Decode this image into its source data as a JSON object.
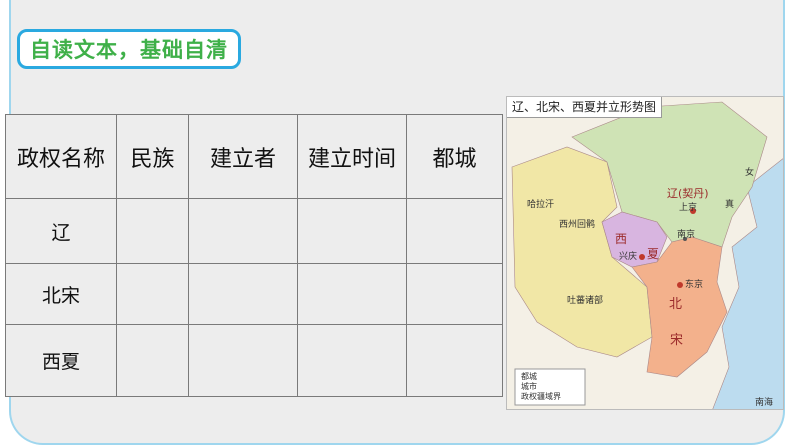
{
  "heading": "自读文本，基础自清",
  "table": {
    "headers": [
      "政权名称",
      "民族",
      "建立者",
      "建立时间",
      "都城"
    ],
    "rows": [
      {
        "name": "辽",
        "cells": [
          "",
          "",
          "",
          ""
        ]
      },
      {
        "name": "北宋",
        "cells": [
          "",
          "",
          "",
          ""
        ]
      },
      {
        "name": "西夏",
        "cells": [
          "",
          "",
          "",
          ""
        ]
      }
    ]
  },
  "map": {
    "title": "辽、北宋、西夏并立形势图",
    "labels": {
      "liao": "辽(契丹)",
      "shangjing": "上京",
      "nanjing": "南京",
      "xia_xi": "西",
      "xia_xia": "夏",
      "xingqing": "兴庆",
      "bei": "北",
      "song": "宋",
      "dongjing": "东京",
      "halatiin": "哈拉汗",
      "xizhou": "西州回鹘",
      "tubo": "吐蕃诸部",
      "nv": "女",
      "zhen": "真",
      "nanhai": "南海"
    },
    "legend": [
      "都城",
      "城市",
      "政权疆域界"
    ],
    "colors": {
      "liao": "#cfe3b5",
      "song": "#f3b18c",
      "xixia": "#d8b5e0",
      "west": "#f1e7a6",
      "sea": "#bcdcef"
    }
  }
}
